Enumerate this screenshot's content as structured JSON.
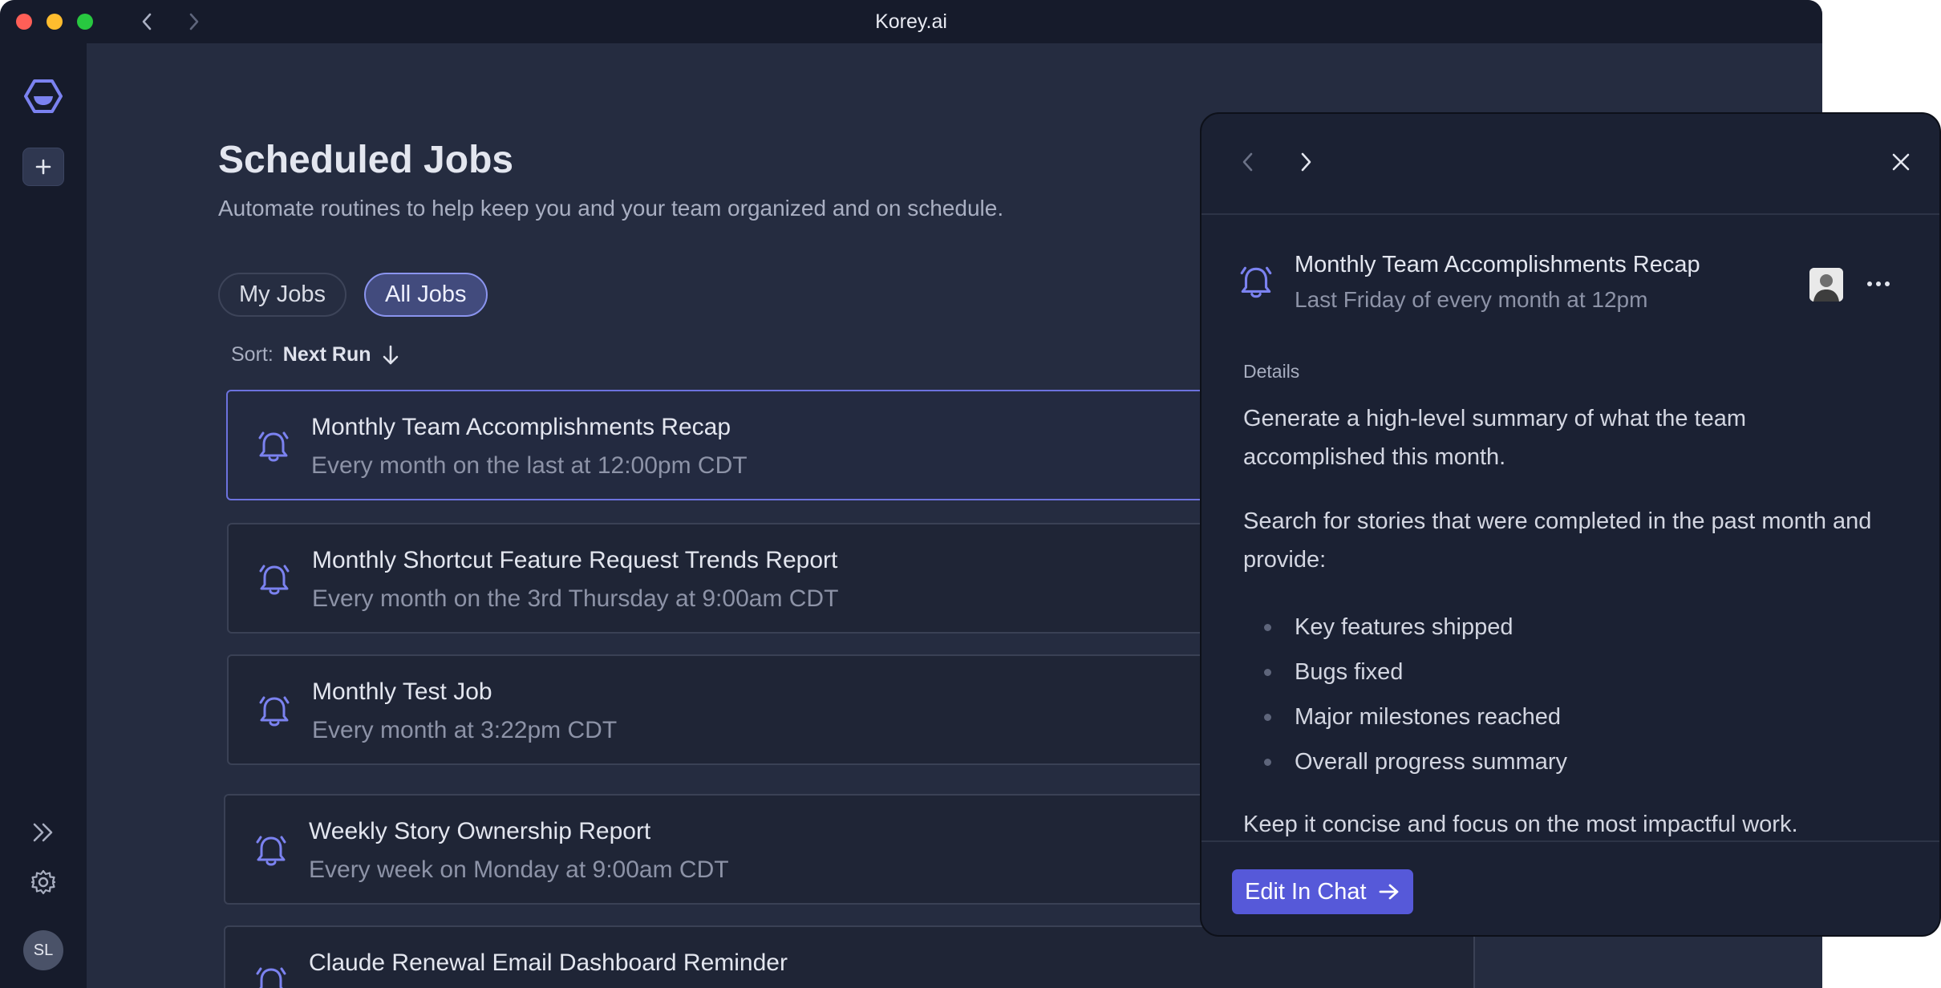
{
  "window": {
    "title": "Korey.ai"
  },
  "sidebar": {
    "avatar_initials": "SL",
    "icons": [
      "korey-logo-icon",
      "plus-icon",
      "double-chevron-right-icon",
      "gear-icon"
    ]
  },
  "page": {
    "title": "Scheduled Jobs",
    "subtitle": "Automate routines to help keep you and your team organized and on schedule."
  },
  "filters": {
    "my_jobs": "My Jobs",
    "all_jobs": "All Jobs",
    "selected": "All Jobs"
  },
  "sort": {
    "label": "Sort:",
    "value": "Next Run"
  },
  "jobs": [
    {
      "title": "Monthly Team Accomplishments Recap",
      "schedule": "Every month on the last at 12:00pm CDT",
      "selected": true
    },
    {
      "title": "Monthly Shortcut Feature Request Trends Report",
      "schedule": "Every month on the 3rd Thursday at 9:00am CDT"
    },
    {
      "title": "Monthly Test Job",
      "schedule": "Every month at 3:22pm CDT"
    },
    {
      "title": "Weekly Story Ownership Report",
      "schedule": "Every week on Monday at 9:00am CDT"
    },
    {
      "title": "Claude Renewal Email Dashboard Reminder",
      "schedule": ""
    }
  ],
  "panel": {
    "title": "Monthly Team Accomplishments Recap",
    "schedule": "Last Friday of every month at 12pm",
    "details_label": "Details",
    "paragraph1": "Generate a high-level summary of what the team accomplished this month.",
    "paragraph2": "Search for stories that were completed in the past month and provide:",
    "bullets": [
      "Key features shipped",
      "Bugs fixed",
      "Major milestones reached",
      "Overall progress summary"
    ],
    "paragraph3": "Keep it concise and focus on the most impactful work.",
    "edit_button": "Edit In Chat"
  },
  "colors": {
    "accent": "#6c72dd",
    "button": "#5659d9",
    "bell": "#7b82f0"
  }
}
